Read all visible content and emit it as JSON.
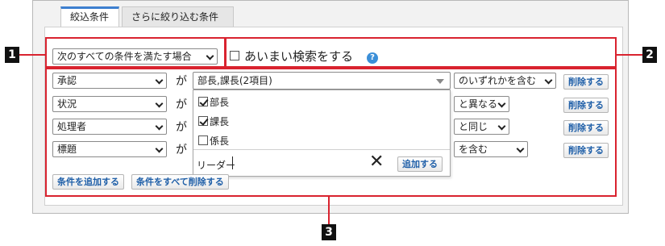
{
  "tabs": [
    {
      "label": "絞込条件"
    },
    {
      "label": "さらに絞り込む条件"
    }
  ],
  "match_mode": {
    "value": "次のすべての条件を満たす場合"
  },
  "fuzzy": {
    "label": "あいまい検索をする",
    "help_icon": "question-icon",
    "checked": false
  },
  "conditions": [
    {
      "field": "承認",
      "ga": "が",
      "value": "部長,課長(2項目)",
      "operator": "のいずれかを含む",
      "delete": "削除する"
    },
    {
      "field": "状況",
      "ga": "が",
      "value": "",
      "operator": "と異なる",
      "delete": "削除する"
    },
    {
      "field": "処理者",
      "ga": "が",
      "value": "",
      "operator": "と同じ",
      "delete": "削除する"
    },
    {
      "field": "標題",
      "ga": "が",
      "value": "",
      "operator": "を含む",
      "delete": "削除する"
    }
  ],
  "dropdown": {
    "options": [
      {
        "label": "部長",
        "checked": true
      },
      {
        "label": "課長",
        "checked": true
      },
      {
        "label": "係長",
        "checked": false
      }
    ],
    "input_value": "リーダー",
    "clear_icon": "close-icon",
    "add_label": "追加する"
  },
  "bottom_buttons": {
    "add_condition": "条件を追加する",
    "delete_all": "条件をすべて削除する"
  },
  "callouts": [
    "1",
    "2",
    "3"
  ],
  "colors": {
    "callout": "#d9232f",
    "tab_accent": "#3d7fcf",
    "link": "#1f5fa8"
  }
}
